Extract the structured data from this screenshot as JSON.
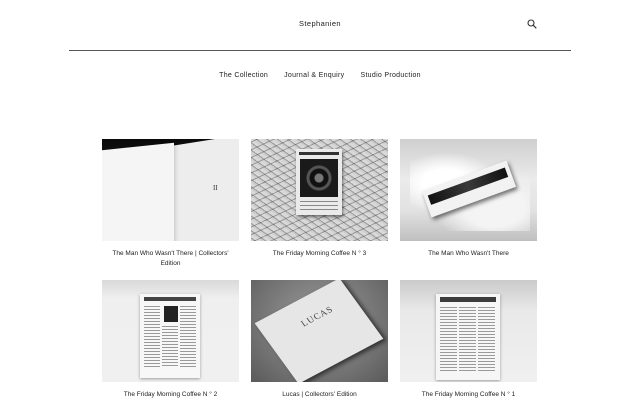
{
  "header": {
    "site_title": "Stephanien",
    "search_icon": "search-icon"
  },
  "nav": {
    "items": [
      {
        "label": "The Collection"
      },
      {
        "label": "Journal & Enquiry"
      },
      {
        "label": "Studio Production"
      }
    ]
  },
  "products": [
    {
      "caption": "The Man Who Wasn't There | Collectors' Edition",
      "thumb_text": "II"
    },
    {
      "caption": "The Friday Morning Coffee N ° 3"
    },
    {
      "caption": "The Man Who Wasn't There"
    },
    {
      "caption": "The Friday Morning Coffee N ° 2"
    },
    {
      "caption": "Lucas | Collectors' Edition",
      "thumb_text": "LUCAS"
    },
    {
      "caption": "The Friday Morning Coffee N ° 1"
    }
  ]
}
